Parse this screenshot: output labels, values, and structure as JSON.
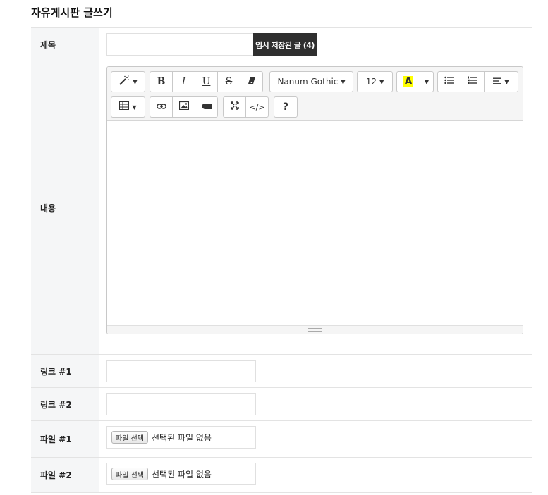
{
  "page": {
    "title": "자유게시판 글쓰기"
  },
  "form": {
    "title_row": {
      "label": "제목",
      "value": "",
      "draft_button": "임시 저장된 글 (4)"
    },
    "content_row": {
      "label": "내용"
    },
    "link1_row": {
      "label": "링크 #1",
      "value": ""
    },
    "link2_row": {
      "label": "링크 #2",
      "value": ""
    },
    "file1_row": {
      "label": "파일 #1",
      "button": "파일 선택",
      "status": "선택된 파일 없음"
    },
    "file2_row": {
      "label": "파일 #2",
      "button": "파일 선택",
      "status": "선택된 파일 없음"
    }
  },
  "editor": {
    "font_name": "Nanum Gothic",
    "font_size": "12",
    "bold": "B",
    "italic": "I",
    "underline": "U",
    "strikethrough": "S",
    "font_color_letter": "A",
    "help": "?",
    "code_view": "</>",
    "highlight_color": "#ffff00",
    "icons": [
      "magic-wand-icon",
      "eraser-icon",
      "unordered-list-icon",
      "ordered-list-icon",
      "align-icon",
      "table-icon",
      "link-icon",
      "picture-icon",
      "video-icon",
      "fullscreen-icon"
    ]
  }
}
